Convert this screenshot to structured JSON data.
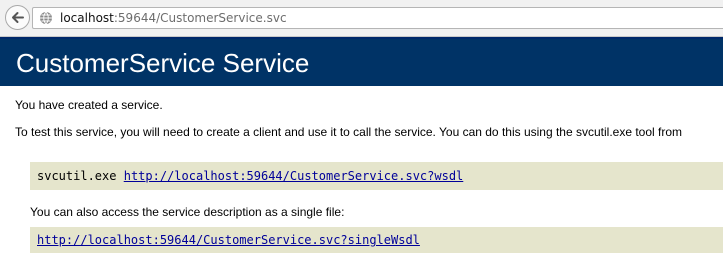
{
  "browser": {
    "url_host": "localhost",
    "url_rest": ":59644/CustomerService.svc"
  },
  "page": {
    "title": "CustomerService Service",
    "created_text": "You have created a service.",
    "instructions_text": "To test this service, you will need to create a client and use it to call the service. You can do this using the svcutil.exe tool from",
    "svcutil_label": "svcutil.exe",
    "wsdl_link": "http://localhost:59644/CustomerService.svc?wsdl",
    "single_file_text": "You can also access the service description as a single file:",
    "single_wsdl_link": "http://localhost:59644/CustomerService.svc?singleWsdl"
  },
  "colors": {
    "banner": "#003366",
    "code_background": "#e5e5cc",
    "link": "#000099"
  },
  "icons": {
    "back": "back-arrow-icon",
    "site": "globe-icon"
  }
}
